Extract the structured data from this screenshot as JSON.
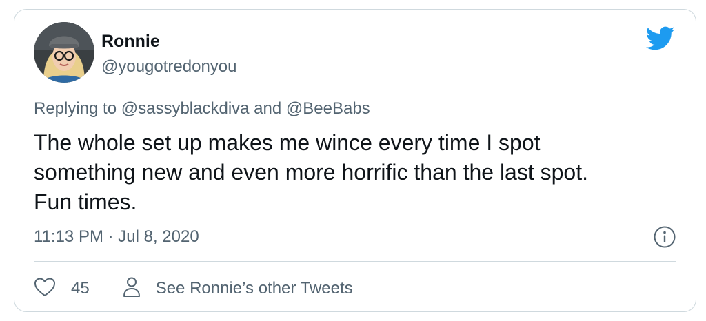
{
  "colors": {
    "brand": "#1d9bf0",
    "text_primary": "#0f1419",
    "text_secondary": "#536471",
    "border": "#cfd9de"
  },
  "author": {
    "name": "Ronnie",
    "handle": "@yougotredonyou",
    "avatar_icon": "user-avatar-photo"
  },
  "brand_icon": "twitter-bird-icon",
  "reply": {
    "prefix": "Replying to ",
    "mention_1": "@sassyblackdiva",
    "joiner": " and ",
    "mention_2": "@BeeBabs"
  },
  "tweet": {
    "line_1": "The whole set up makes me wince every time I spot",
    "line_2": "something new and even more horrific than the last spot.",
    "line_3": "Fun times."
  },
  "timestamp": "11:13 PM · Jul 8, 2020",
  "info_icon": "info-icon",
  "actions": {
    "like_icon": "heart-icon",
    "like_count": "45",
    "profile_icon": "person-icon",
    "other_tweets_label": "See Ronnie’s other Tweets"
  }
}
